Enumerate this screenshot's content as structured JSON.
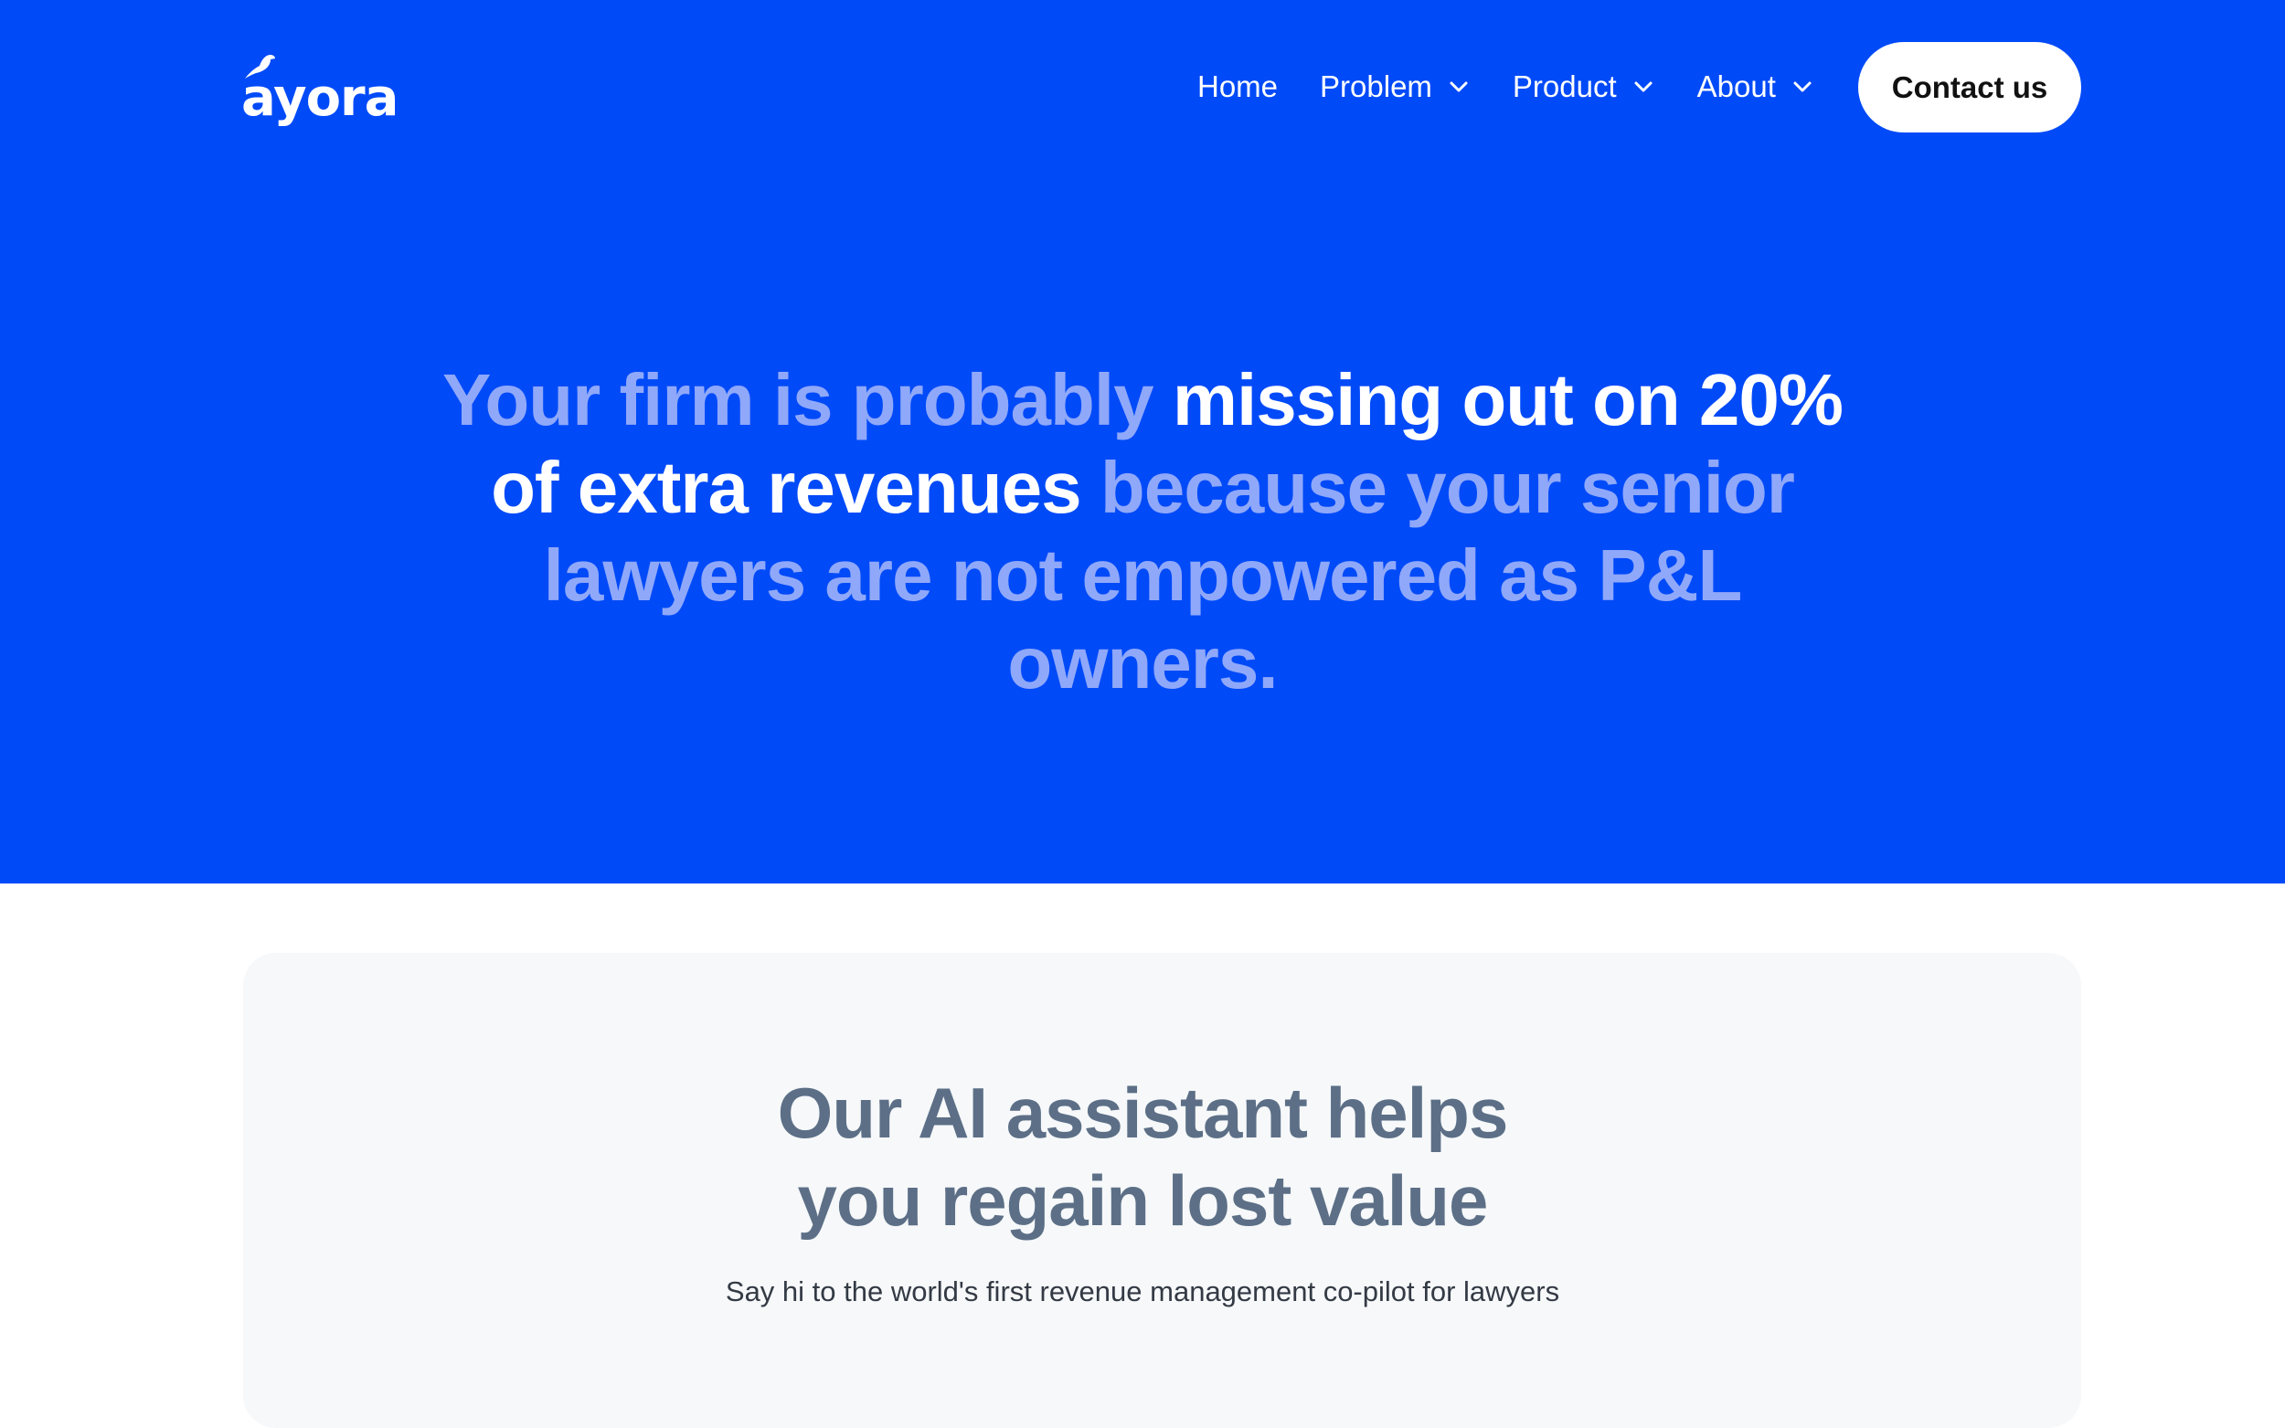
{
  "colors": {
    "hero_background": "#004AF8",
    "headline_muted": "#8FA8FA",
    "headline_strong": "#FFFFFF",
    "card_background": "#F6F8FA",
    "card_title": "#5C6F86"
  },
  "header": {
    "logo_text": "ayora",
    "logo_icon": "bird-icon",
    "nav": {
      "home": "Home",
      "problem": "Problem",
      "product": "Product",
      "about": "About"
    },
    "dropdown_icon": "chevron-down-icon",
    "contact_label": "Contact us"
  },
  "hero": {
    "headline_part1": "Your firm is probably",
    "headline_part2": "missing out on 20% of extra revenues",
    "headline_part3": "because your senior lawyers are not empowered as P&L owners."
  },
  "card": {
    "title_line1": "Our AI assistant helps",
    "title_line2": "you regain lost value",
    "subtitle": "Say hi to the world's first revenue management co-pilot for lawyers"
  }
}
